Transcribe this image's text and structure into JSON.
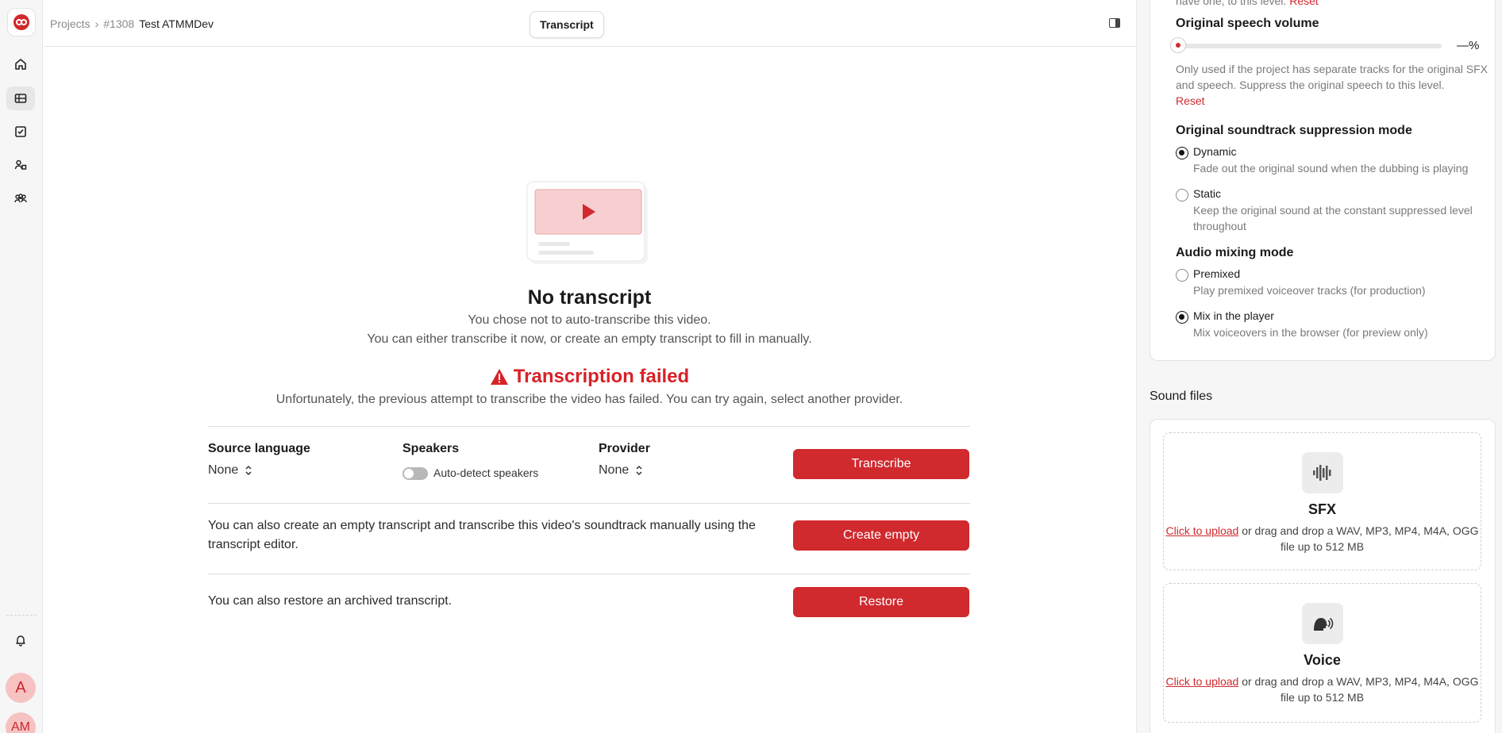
{
  "breadcrumb": {
    "projects": "Projects",
    "separator": "›",
    "id": "#1308",
    "name": "Test ATMMDev"
  },
  "header": {
    "tab_label": "Transcript"
  },
  "main": {
    "title": "No transcript",
    "subtitle_line1": "You chose not to auto-transcribe this video.",
    "subtitle_line2": "You can either transcribe it now, or create an empty transcript to fill in manually.",
    "error_title": "Transcription failed",
    "error_text": "Unfortunately, the previous attempt to transcribe the video has failed. You can try again, select another provider.",
    "source_language_label": "Source language",
    "source_language_value": "None",
    "speakers_label": "Speakers",
    "auto_detect_label": "Auto-detect speakers",
    "auto_detect_on": false,
    "provider_label": "Provider",
    "provider_value": "None",
    "transcribe_button": "Transcribe",
    "create_empty_text": "You can also create an empty transcript and transcribe this video's soundtrack manually using the transcript editor.",
    "create_empty_button": "Create empty",
    "restore_text": "You can also restore an archived transcript.",
    "restore_button": "Restore"
  },
  "right_panel": {
    "top_cut_text": "have one, to this level.",
    "top_cut_reset": "Reset",
    "speech_volume_label": "Original speech volume",
    "speech_volume_value": "—%",
    "speech_volume_help": "Only used if the project has separate tracks for the original SFX and speech. Suppress the original speech to this level.",
    "reset": "Reset",
    "suppression_label": "Original soundtrack suppression mode",
    "suppression_options": [
      {
        "label": "Dynamic",
        "desc": "Fade out the original sound when the dubbing is playing",
        "selected": true
      },
      {
        "label": "Static",
        "desc": "Keep the original sound at the constant suppressed level throughout",
        "selected": false
      }
    ],
    "mixing_label": "Audio mixing mode",
    "mixing_options": [
      {
        "label": "Premixed",
        "desc": "Play premixed voiceover tracks (for production)",
        "selected": false
      },
      {
        "label": "Mix in the player",
        "desc": "Mix voiceovers in the browser (for preview only)",
        "selected": true
      }
    ],
    "sound_files_label": "Sound files",
    "uploads": [
      {
        "name": "SFX",
        "link": "Click to upload",
        "text": "or drag and drop a WAV, MP3, MP4, M4A, OGG file up to 512 MB"
      },
      {
        "name": "Voice",
        "link": "Click to upload",
        "text": "or drag and drop a WAV, MP3, MP4, M4A, OGG file up to 512 MB"
      }
    ]
  },
  "user": {
    "avatar1": "A",
    "avatar2": "AM"
  },
  "colors": {
    "accent": "#d0292e",
    "error": "#d72228"
  }
}
